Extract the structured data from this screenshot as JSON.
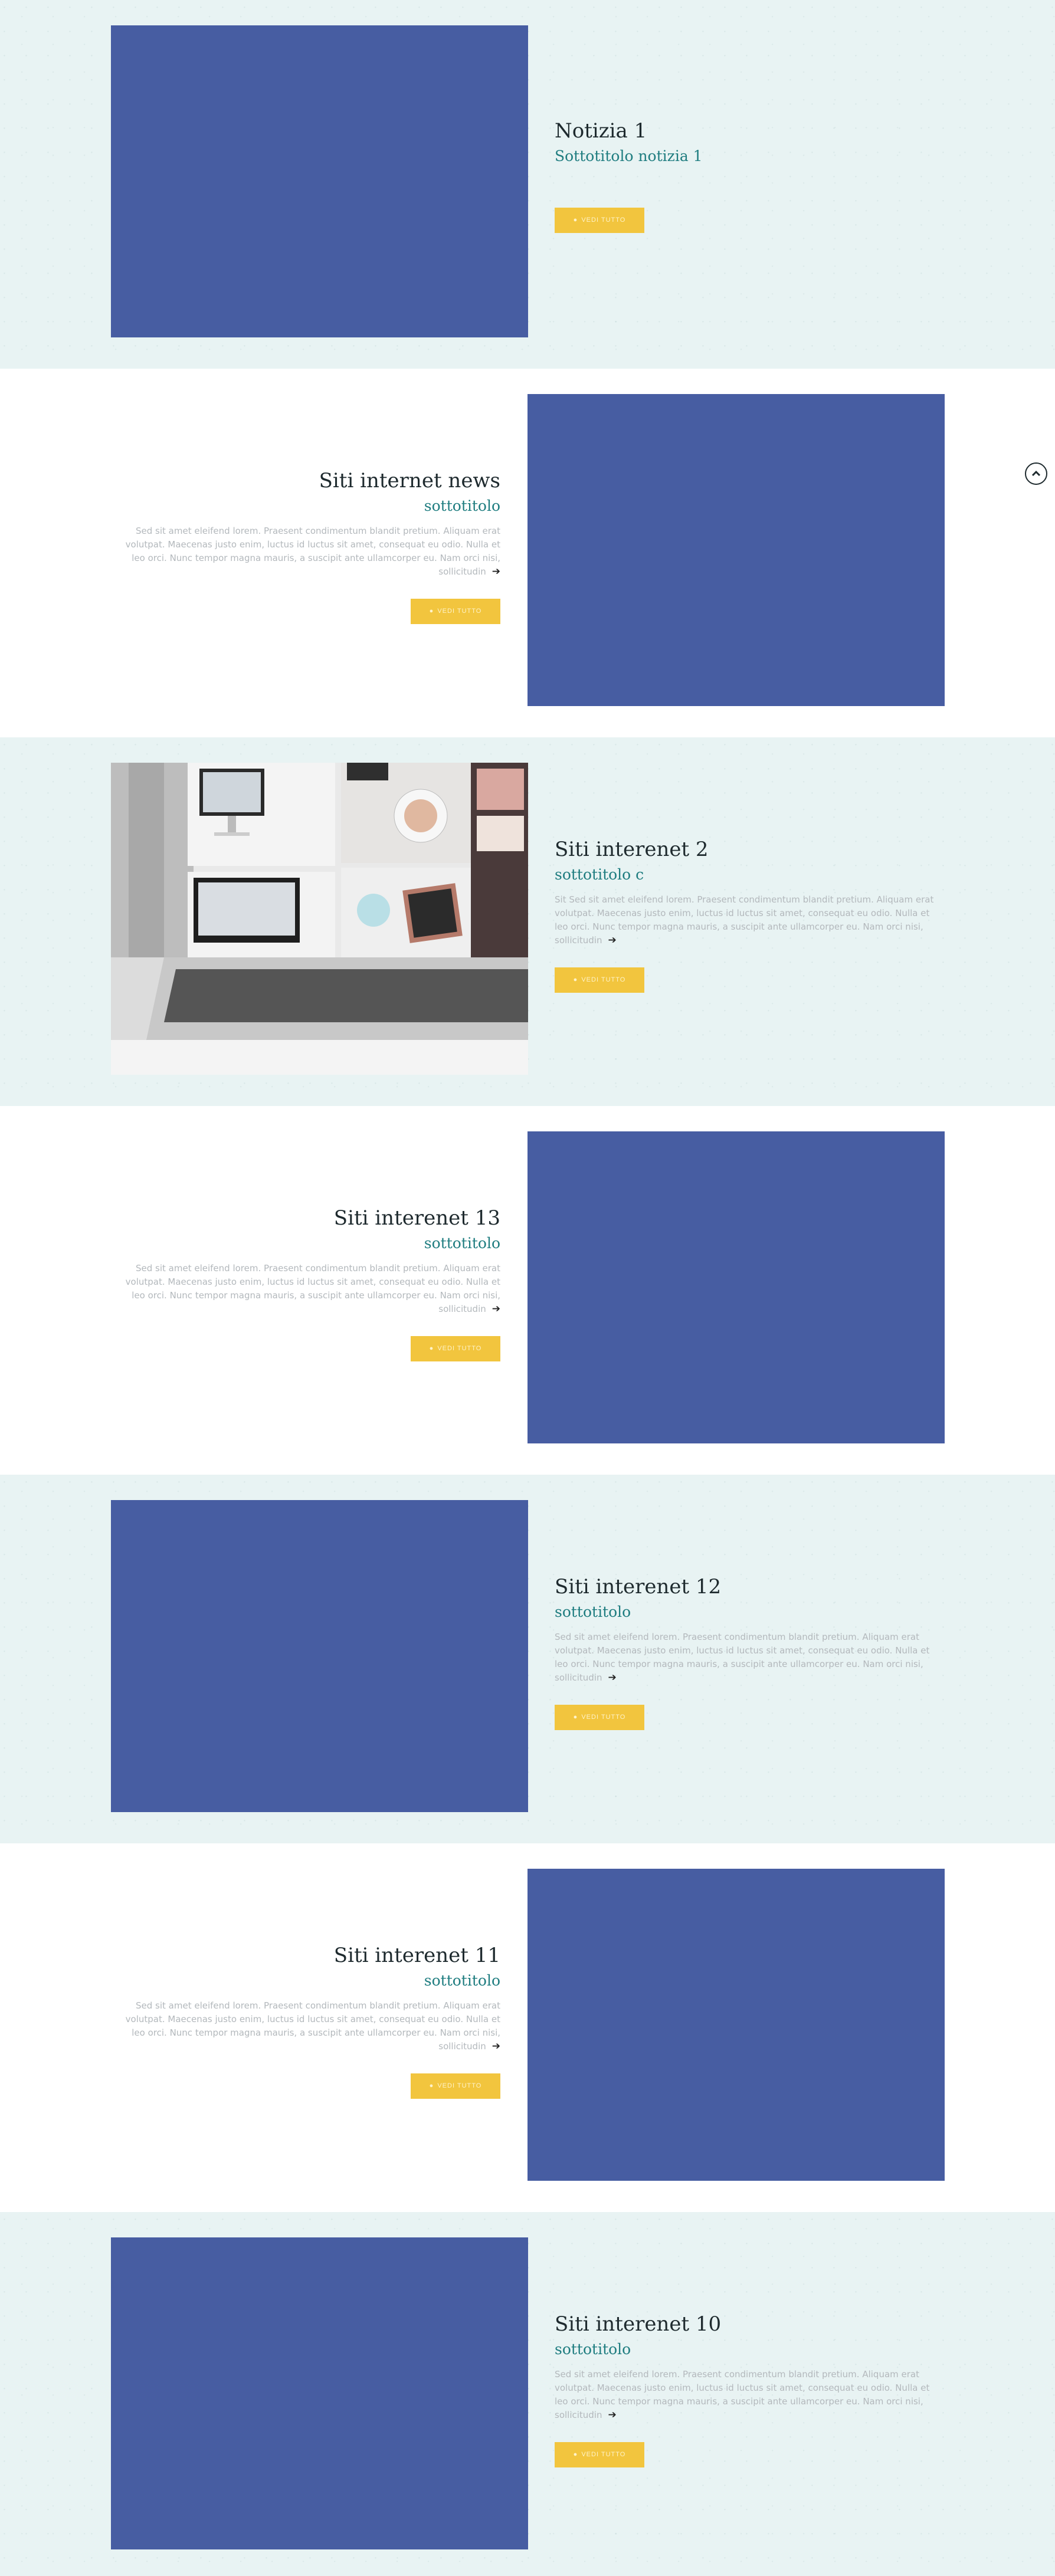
{
  "lorem": "Sed sit amet eleifend lorem. Praesent condimentum blandit pretium. Aliquam erat volutpat. Maecenas justo enim, luctus id luctus sit amet, consequat eu odio. Nulla et leo orci. Nunc tempor magna mauris, a suscipit ante ullamcorper eu. Nam orci nisi, sollicitudin",
  "button_label": "VEDI TUTTO",
  "colors": {
    "accent": "#f2c53e",
    "image_placeholder": "#475da2",
    "subtitle": "#1f7d80",
    "tint_bg": "#e8f3f3"
  },
  "articles": [
    {
      "title": "Notizia 1",
      "subtitle": "Sottotitolo notizia 1",
      "body": ""
    },
    {
      "title": "Siti internet news",
      "subtitle": "sottotitolo"
    },
    {
      "title": "Siti interenet 2",
      "subtitle": "sottotitolo c",
      "body_prefix": "Sit "
    },
    {
      "title": "Siti interenet 13",
      "subtitle": "sottotitolo"
    },
    {
      "title": "Siti interenet 12",
      "subtitle": "sottotitolo"
    },
    {
      "title": "Siti interenet 11",
      "subtitle": "sottotitolo"
    },
    {
      "title": "Siti interenet 10",
      "subtitle": "sottotitolo"
    }
  ],
  "icons": {
    "scroll_top": "chevron-up-icon",
    "button": "eye-icon",
    "read_more": "arrow-right-icon"
  }
}
